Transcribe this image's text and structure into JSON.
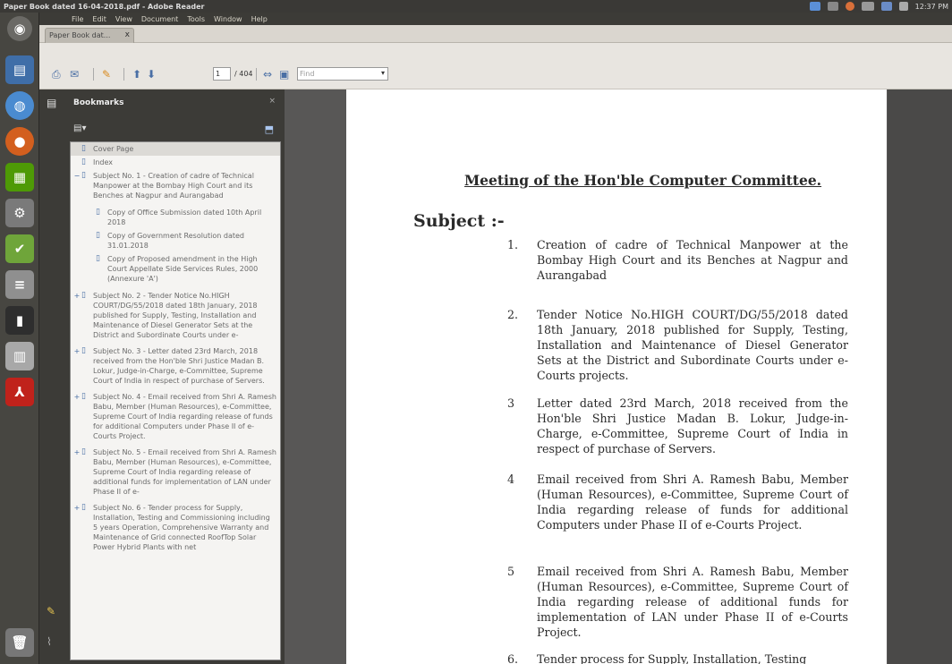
{
  "window": {
    "title": "Paper Book dated 16-04-2018.pdf - Adobe Reader",
    "clock": "12:37 PM"
  },
  "menu": [
    "File",
    "Edit",
    "View",
    "Document",
    "Tools",
    "Window",
    "Help"
  ],
  "tab": {
    "label": "Paper Book dat...",
    "close": "x"
  },
  "toolbar": {
    "page_current": "1",
    "page_total": "/ 404",
    "zoom_placeholder": "Find"
  },
  "bookmarks": {
    "title": "Bookmarks",
    "close": "×",
    "items": [
      {
        "label": "Cover Page",
        "indent": 0,
        "expander": ""
      },
      {
        "label": "Index",
        "indent": 0,
        "expander": ""
      },
      {
        "label": "Subject No. 1 - Creation of cadre of Technical Manpower at the Bombay High Court and its Benches at Nagpur and Aurangabad",
        "indent": 0,
        "expander": "−"
      },
      {
        "label": "Copy of Office Submission dated 10th April 2018",
        "indent": 1,
        "expander": ""
      },
      {
        "label": "Copy of Government Resolution dated 31.01.2018",
        "indent": 1,
        "expander": ""
      },
      {
        "label": "Copy of Proposed amendment in the High Court Appellate Side Services Rules, 2000 (Annexure 'A')",
        "indent": 1,
        "expander": ""
      },
      {
        "label": "Subject No. 2 - Tender Notice No.HIGH COURT/DG/55/2018 dated 18th January, 2018 published for Supply, Testing, Installation and Maintenance of Diesel Generator Sets at the District and Subordinate Courts under e-",
        "indent": 0,
        "expander": "+"
      },
      {
        "label": "Subject No. 3 - Letter dated 23rd March, 2018 received from the Hon'ble Shri Justice Madan B. Lokur, Judge-in-Charge, e-Committee, Supreme Court of India in respect of purchase of Servers.",
        "indent": 0,
        "expander": "+"
      },
      {
        "label": "Subject No. 4 - Email received from Shri A. Ramesh Babu, Member (Human Resources), e-Committee, Supreme Court of India regarding release of funds for additional Computers under Phase II of e-Courts Project.",
        "indent": 0,
        "expander": "+"
      },
      {
        "label": "Subject No. 5 - Email received from Shri A. Ramesh Babu, Member (Human Resources), e-Committee, Supreme Court of India regarding release of additional funds for implementation of LAN under Phase II of e-",
        "indent": 0,
        "expander": "+"
      },
      {
        "label": "Subject No. 6 - Tender process for Supply, Installation, Testing and Commissioning including 5 years Operation, Comprehensive Warranty and Maintenance of Grid connected RoofTop Solar Power Hybrid Plants with net",
        "indent": 0,
        "expander": "+"
      }
    ]
  },
  "document": {
    "heading": "Meeting of the Hon'ble Computer Committee.",
    "subject_label": "Subject :-",
    "items": [
      {
        "num": "1.",
        "text": "Creation of cadre of Technical Manpower at the Bombay High Court and its Benches at Nagpur and Aurangabad"
      },
      {
        "num": "2.",
        "text": "Tender Notice No.HIGH COURT/DG/55/2018 dated 18th January, 2018 published for Supply, Testing, Installation and Maintenance of Diesel Generator Sets at the District and Subordinate Courts under e-Courts projects."
      },
      {
        "num": "3",
        "text": "Letter dated 23rd March, 2018 received from the Hon'ble Shri Justice Madan B. Lokur, Judge-in-Charge, e-Committee, Supreme Court of India in respect of purchase of Servers."
      },
      {
        "num": "4",
        "text": "Email received from Shri A. Ramesh Babu, Member (Human Resources), e-Committee, Supreme Court of India regarding release of funds for additional Computers under Phase II of e-Courts Project."
      },
      {
        "num": "5",
        "text": "Email received from Shri A. Ramesh Babu, Member (Human Resources), e-Committee, Supreme Court of India regarding release of additional funds for implementation of LAN under Phase II of e-Courts Project."
      },
      {
        "num": "6.",
        "text": "Tender process for Supply, Installation, Testing"
      }
    ]
  }
}
